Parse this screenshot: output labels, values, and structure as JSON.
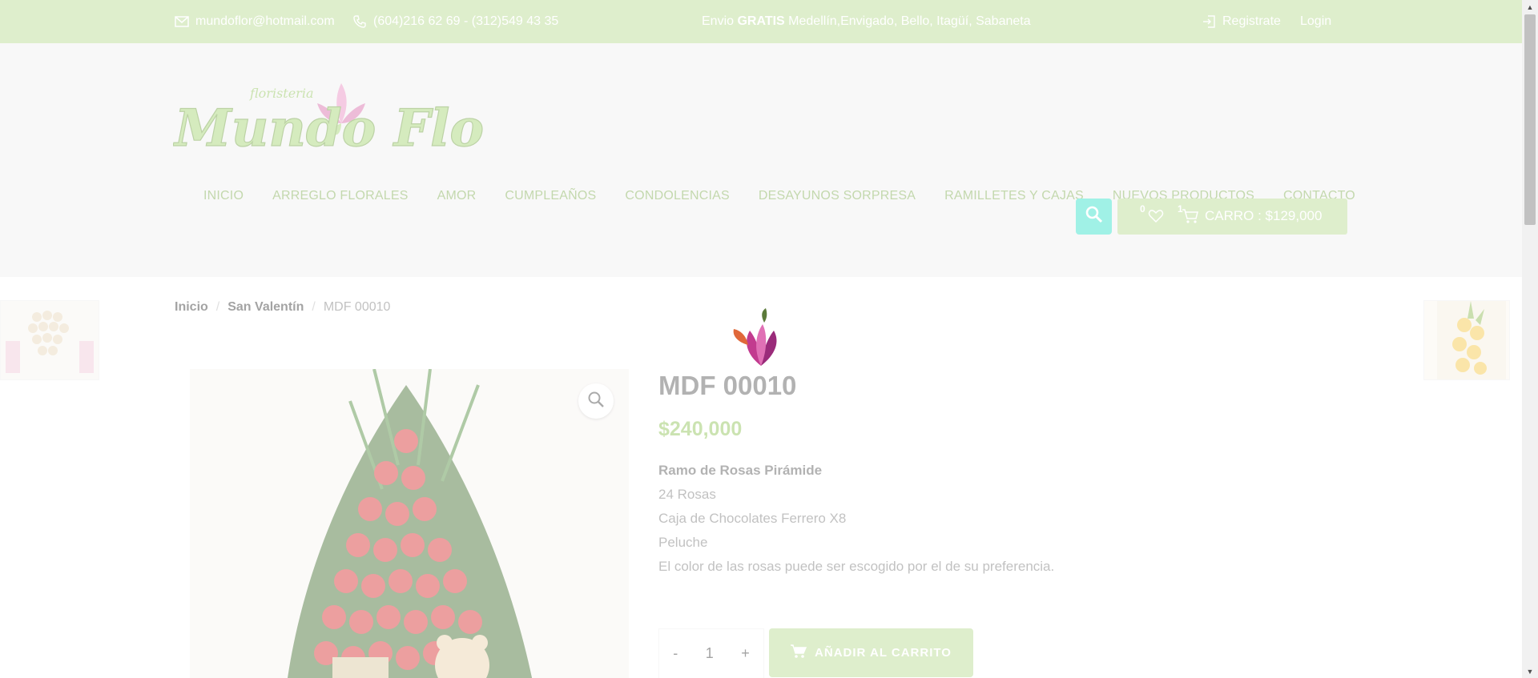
{
  "topbar": {
    "email": "mundoflor@hotmail.com",
    "phone": "(604)216 62 69 - (312)549 43 35",
    "promo_prefix": "Envio ",
    "promo_bold": "GRATIS",
    "promo_suffix": " Medellín,Envigado, Bello, Itagüí, Sabaneta",
    "register": "Registrate",
    "login": "Login"
  },
  "header": {
    "logo_small_text": "floristeria",
    "logo_text": "Mundo Flor",
    "nav": [
      "INICIO",
      "ARREGLO FLORALES",
      "AMOR",
      "CUMPLEAÑOS",
      "CONDOLENCIAS",
      "DESAYUNOS SORPRESA",
      "RAMILLETES Y CAJAS",
      "NUEVOS PRODUCTOS",
      "CONTACTO"
    ],
    "wishlist_count": "0",
    "cart_count": "1",
    "cart_label": "CARRO : $129,000"
  },
  "breadcrumb": {
    "home": "Inicio",
    "category": "San Valentín",
    "current": "MDF 00010"
  },
  "product": {
    "title": "MDF 00010",
    "price": "$240,000",
    "desc_title": "Ramo de Rosas Pirámide",
    "desc_lines": [
      "24 Rosas",
      "Caja de Chocolates Ferrero X8",
      "Peluche",
      "El color de las rosas puede ser escogido por el de su preferencia."
    ],
    "qty_minus": "-",
    "qty_value": "1",
    "qty_plus": "+",
    "add_to_cart": "AÑADIR AL CARRITO"
  },
  "colors": {
    "topbar": "#b5d98e",
    "nav_text": "#7aa84a",
    "search_button": "#2ee0c8",
    "price": "#8cc152"
  },
  "icons": [
    "envelope-icon",
    "phone-icon",
    "login-icon",
    "search-icon",
    "heart-icon",
    "cart-icon",
    "zoom-icon",
    "flower-loader-icon"
  ]
}
